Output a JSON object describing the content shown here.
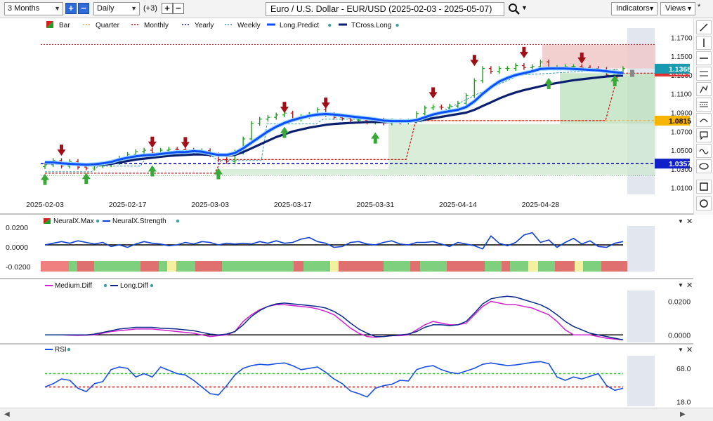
{
  "toolbar": {
    "range": "3 Months",
    "interval": "Daily",
    "extra_count": "(+3)",
    "title": "Euro / U.S. Dollar - EUR/USD (2025-02-03 - 2025-05-07)",
    "indicators": "Indicators",
    "views": "Views"
  },
  "colors": {
    "long_predict": "#0d4fff",
    "tcross_long": "#0a1f6e",
    "monthly": "#d01010",
    "yearly": "#1010c0",
    "quarter": "#e8a030",
    "weekly": "#30a0a0",
    "strength": "#1040d0",
    "medium_diff": "#d020d0",
    "long_diff": "#0a2a8a",
    "rsi": "#1a50e0",
    "rsi_upper": "#40c040",
    "rsi_lower": "#d01010",
    "badge_price": "#1a9ab0",
    "badge_quarter": "#f7b500",
    "badge_yearly": "#1020c8"
  },
  "chart_data": [
    {
      "type": "candlestick",
      "title": "Euro / U.S. Dollar - EUR/USD (2025-02-03 - 2025-05-07)",
      "legend": [
        "Bar",
        "Quarter",
        "Monthly",
        "Yearly",
        "Weekly",
        "Long.Predict",
        "TCross.Long"
      ],
      "x_tick_labels": [
        "2025-02-03",
        "2025-02-17",
        "2025-03-03",
        "2025-03-17",
        "2025-03-31",
        "2025-04-14",
        "2025-04-28"
      ],
      "y_tick_labels": [
        "1.1700",
        "1.1500",
        "1.1300",
        "1.1100",
        "1.0900",
        "1.0700",
        "1.0500",
        "1.0300",
        "1.0100"
      ],
      "ylim": [
        1.0,
        1.18
      ],
      "price_badge": "1.1368",
      "badge_hidden": "1.1324",
      "quarter_badge": "1.0815",
      "yearly_badge": "1.0357",
      "close": [
        1.0345,
        1.039,
        1.033,
        1.038,
        1.032,
        1.031,
        1.0335,
        1.0345,
        1.037,
        1.0415,
        1.0455,
        1.0485,
        1.05,
        1.047,
        1.05,
        1.051,
        1.0505,
        1.05,
        1.048,
        1.0495,
        1.045,
        1.04,
        1.038,
        1.048,
        1.062,
        1.0785,
        1.083,
        1.085,
        1.0875,
        1.0895,
        1.083,
        1.086,
        1.088,
        1.093,
        1.088,
        1.085,
        1.084,
        1.082,
        1.082,
        1.08,
        1.082,
        1.079,
        1.081,
        1.08,
        1.081,
        1.089,
        1.095,
        1.096,
        1.0955,
        1.097,
        1.1,
        1.108,
        1.124,
        1.137,
        1.134,
        1.137,
        1.137,
        1.14,
        1.138,
        1.139,
        1.144,
        1.138,
        1.138,
        1.139,
        1.139,
        1.138,
        1.137,
        1.136,
        1.13,
        1.134,
        1.1368
      ],
      "long_predict": [
        1.037,
        1.037,
        1.036,
        1.0355,
        1.035,
        1.0345,
        1.035,
        1.036,
        1.0375,
        1.04,
        1.042,
        1.0435,
        1.0445,
        1.045,
        1.046,
        1.047,
        1.048,
        1.048,
        1.049,
        1.0485,
        1.0465,
        1.045,
        1.045,
        1.047,
        1.052,
        1.058,
        1.064,
        1.07,
        1.075,
        1.079,
        1.082,
        1.0845,
        1.0865,
        1.088,
        1.0885,
        1.088,
        1.087,
        1.086,
        1.085,
        1.084,
        1.083,
        1.0815,
        1.081,
        1.081,
        1.081,
        1.082,
        1.085,
        1.088,
        1.09,
        1.0915,
        1.093,
        1.096,
        1.102,
        1.11,
        1.117,
        1.123,
        1.127,
        1.13,
        1.132,
        1.134,
        1.1365,
        1.137,
        1.137,
        1.137,
        1.1365,
        1.136,
        1.1355,
        1.135,
        1.134,
        1.133,
        1.132
      ],
      "tcross_long": [
        1.036,
        1.036,
        1.0355,
        1.035,
        1.0345,
        1.034,
        1.034,
        1.0345,
        1.0355,
        1.037,
        1.0385,
        1.04,
        1.041,
        1.042,
        1.043,
        1.044,
        1.0445,
        1.045,
        1.0455,
        1.0455,
        1.045,
        1.0445,
        1.044,
        1.045,
        1.048,
        1.052,
        1.056,
        1.06,
        1.064,
        1.067,
        1.07,
        1.072,
        1.074,
        1.0755,
        1.077,
        1.078,
        1.0785,
        1.079,
        1.0795,
        1.08,
        1.08,
        1.08,
        1.08,
        1.08,
        1.0805,
        1.081,
        1.0825,
        1.084,
        1.0855,
        1.087,
        1.0885,
        1.09,
        1.093,
        1.097,
        1.101,
        1.105,
        1.1085,
        1.1115,
        1.114,
        1.116,
        1.118,
        1.12,
        1.1215,
        1.123,
        1.1245,
        1.1255,
        1.1265,
        1.1275,
        1.1285,
        1.129,
        1.1295
      ]
    },
    {
      "type": "line",
      "legend": [
        "NeuralX.Max",
        "NeuralX.Strength"
      ],
      "y_tick_labels": [
        "0.0200",
        "0.0000",
        "-0.0200"
      ],
      "ylim": [
        -0.03,
        0.03
      ],
      "strength": [
        0.0,
        0.002,
        0.004,
        0.002,
        0.005,
        0.003,
        0.001,
        0.003,
        -0.002,
        0.0,
        -0.003,
        0.001,
        0.004,
        0.002,
        0.001,
        -0.001,
        0.0,
        0.003,
        0.001,
        0.004,
        0.003,
        0.0,
        0.002,
        0.001,
        0.002,
        0.001,
        0.004,
        0.002,
        0.005,
        0.002,
        0.003,
        0.007,
        0.009,
        0.004,
        0.002,
        -0.003,
        -0.002,
        0.003,
        0.004,
        0.001,
        0.0,
        0.003,
        0.005,
        0.001,
        0.0,
        0.003,
        0.003,
        0.004,
        0.001,
        -0.002,
        0.003,
        0.001,
        -0.001,
        -0.005,
        0.011,
        0.002,
        -0.001,
        0.003,
        0.012,
        0.015,
        0.003,
        0.006,
        -0.003,
        0.003,
        0.008,
        0.001,
        0.005,
        -0.002,
        -0.003,
        0.002,
        0.004
      ]
    },
    {
      "type": "line",
      "legend": [
        "Medium.Diff",
        "Long.Diff"
      ],
      "y_tick_labels": [
        "0.0200",
        "0.0000"
      ],
      "ylim": [
        -0.0045,
        0.029
      ],
      "medium_diff": [
        0.0,
        0.0,
        0.0,
        -0.0002,
        -0.0003,
        -0.0002,
        0.0,
        0.001,
        0.002,
        0.0025,
        0.003,
        0.0035,
        0.0035,
        0.0035,
        0.003,
        0.0025,
        0.002,
        0.0015,
        0.001,
        0.0,
        -0.001,
        -0.0005,
        0.0,
        0.002,
        0.008,
        0.012,
        0.015,
        0.017,
        0.018,
        0.018,
        0.0175,
        0.017,
        0.0165,
        0.0155,
        0.014,
        0.012,
        0.008,
        0.004,
        0.001,
        -0.001,
        -0.0015,
        -0.001,
        -0.0005,
        -0.0005,
        0.0,
        0.003,
        0.006,
        0.008,
        0.007,
        0.006,
        0.006,
        0.007,
        0.012,
        0.017,
        0.02,
        0.019,
        0.018,
        0.018,
        0.017,
        0.016,
        0.014,
        0.012,
        0.008,
        0.003,
        0.0,
        0.0,
        0.0,
        -0.001,
        -0.002,
        -0.0025,
        -0.003
      ],
      "long_diff": [
        0.0,
        0.0,
        0.0,
        0.0,
        0.0,
        0.0,
        0.0005,
        0.0015,
        0.0025,
        0.0035,
        0.004,
        0.0045,
        0.0045,
        0.0045,
        0.004,
        0.0038,
        0.0035,
        0.003,
        0.0025,
        0.0015,
        0.0005,
        0.0,
        0.0005,
        0.002,
        0.006,
        0.011,
        0.0145,
        0.017,
        0.0185,
        0.019,
        0.0185,
        0.018,
        0.0175,
        0.017,
        0.016,
        0.014,
        0.011,
        0.007,
        0.0035,
        0.001,
        -0.001,
        -0.001,
        -0.0005,
        0.0,
        0.0005,
        0.002,
        0.0045,
        0.006,
        0.006,
        0.0055,
        0.006,
        0.008,
        0.013,
        0.0185,
        0.0215,
        0.0225,
        0.023,
        0.0225,
        0.021,
        0.0195,
        0.018,
        0.0155,
        0.012,
        0.008,
        0.005,
        0.003,
        0.001,
        0.0,
        -0.001,
        -0.002,
        -0.003
      ]
    },
    {
      "type": "line",
      "legend": [
        "RSI"
      ],
      "y_tick_labels": [
        "68.0",
        "18.0"
      ],
      "ylim": [
        10,
        90
      ],
      "upper": 60,
      "lower": 40,
      "rsi": [
        40,
        45,
        52,
        50,
        38,
        33,
        45,
        48,
        66,
        70,
        68,
        55,
        60,
        55,
        70,
        65,
        60,
        58,
        50,
        40,
        30,
        28,
        42,
        58,
        68,
        72,
        74,
        73,
        75,
        76,
        72,
        66,
        68,
        70,
        62,
        52,
        45,
        34,
        30,
        25,
        38,
        42,
        44,
        50,
        49,
        66,
        70,
        72,
        66,
        62,
        60,
        64,
        68,
        74,
        76,
        74,
        72,
        73,
        75,
        77,
        78,
        75,
        55,
        50,
        55,
        52,
        56,
        60,
        42,
        35,
        38
      ]
    }
  ]
}
